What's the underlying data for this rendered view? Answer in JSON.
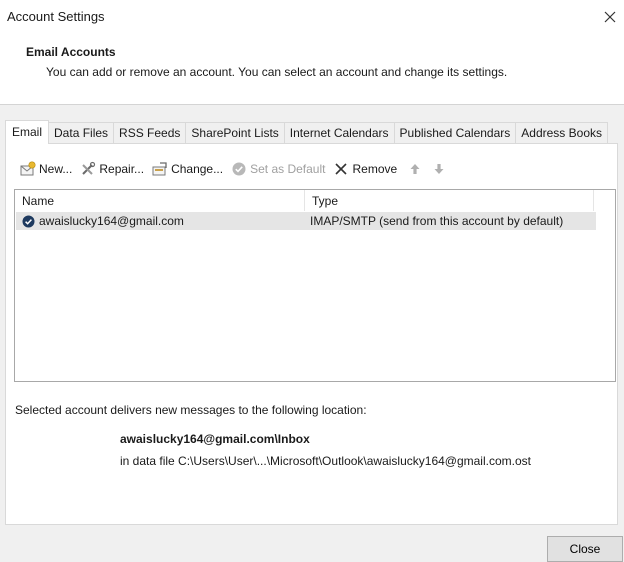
{
  "window": {
    "title": "Account Settings"
  },
  "header": {
    "title": "Email Accounts",
    "subtitle": "You can add or remove an account. You can select an account and change its settings."
  },
  "tabs": [
    {
      "label": "Email",
      "active": true
    },
    {
      "label": "Data Files"
    },
    {
      "label": "RSS Feeds"
    },
    {
      "label": "SharePoint Lists"
    },
    {
      "label": "Internet Calendars"
    },
    {
      "label": "Published Calendars"
    },
    {
      "label": "Address Books"
    }
  ],
  "toolbar": {
    "new_label": "New...",
    "repair_label": "Repair...",
    "change_label": "Change...",
    "set_default_label": "Set as Default",
    "remove_label": "Remove"
  },
  "table": {
    "columns": [
      "Name",
      "Type"
    ],
    "rows": [
      {
        "name": "awaislucky164@gmail.com",
        "type": "IMAP/SMTP (send from this account by default)",
        "is_default": true
      }
    ]
  },
  "location": {
    "label": "Selected account delivers new messages to the following location:",
    "account": "awaislucky164@gmail.com\\Inbox",
    "path": "in data file C:\\Users\\User\\...\\Microsoft\\Outlook\\awaislucky164@gmail.com.ost"
  },
  "footer": {
    "close_label": "Close"
  },
  "colors": {
    "accent": "#1e3a5f",
    "selection": "#e5e5e5",
    "panel_bg": "#f0f0f0"
  }
}
